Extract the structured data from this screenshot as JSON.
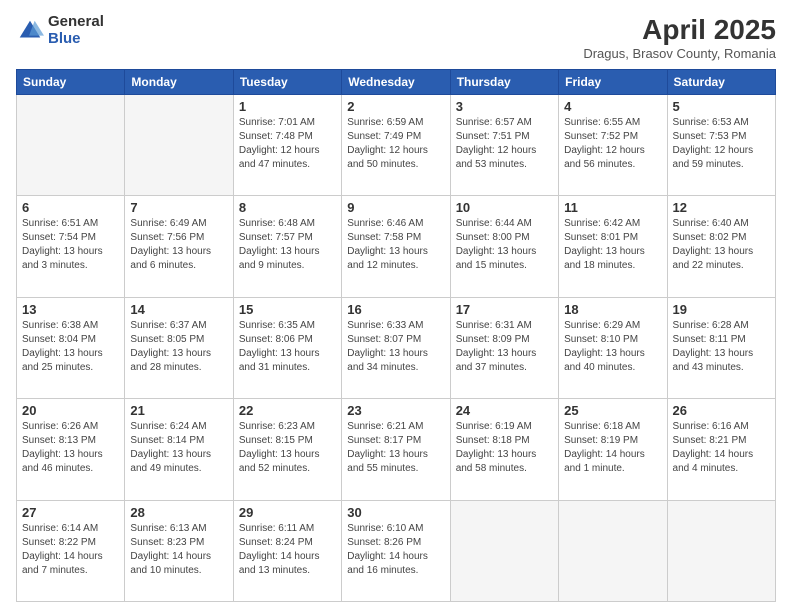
{
  "logo": {
    "general": "General",
    "blue": "Blue"
  },
  "title": "April 2025",
  "subtitle": "Dragus, Brasov County, Romania",
  "weekdays": [
    "Sunday",
    "Monday",
    "Tuesday",
    "Wednesday",
    "Thursday",
    "Friday",
    "Saturday"
  ],
  "weeks": [
    [
      {
        "day": "",
        "info": ""
      },
      {
        "day": "",
        "info": ""
      },
      {
        "day": "1",
        "info": "Sunrise: 7:01 AM\nSunset: 7:48 PM\nDaylight: 12 hours and 47 minutes."
      },
      {
        "day": "2",
        "info": "Sunrise: 6:59 AM\nSunset: 7:49 PM\nDaylight: 12 hours and 50 minutes."
      },
      {
        "day": "3",
        "info": "Sunrise: 6:57 AM\nSunset: 7:51 PM\nDaylight: 12 hours and 53 minutes."
      },
      {
        "day": "4",
        "info": "Sunrise: 6:55 AM\nSunset: 7:52 PM\nDaylight: 12 hours and 56 minutes."
      },
      {
        "day": "5",
        "info": "Sunrise: 6:53 AM\nSunset: 7:53 PM\nDaylight: 12 hours and 59 minutes."
      }
    ],
    [
      {
        "day": "6",
        "info": "Sunrise: 6:51 AM\nSunset: 7:54 PM\nDaylight: 13 hours and 3 minutes."
      },
      {
        "day": "7",
        "info": "Sunrise: 6:49 AM\nSunset: 7:56 PM\nDaylight: 13 hours and 6 minutes."
      },
      {
        "day": "8",
        "info": "Sunrise: 6:48 AM\nSunset: 7:57 PM\nDaylight: 13 hours and 9 minutes."
      },
      {
        "day": "9",
        "info": "Sunrise: 6:46 AM\nSunset: 7:58 PM\nDaylight: 13 hours and 12 minutes."
      },
      {
        "day": "10",
        "info": "Sunrise: 6:44 AM\nSunset: 8:00 PM\nDaylight: 13 hours and 15 minutes."
      },
      {
        "day": "11",
        "info": "Sunrise: 6:42 AM\nSunset: 8:01 PM\nDaylight: 13 hours and 18 minutes."
      },
      {
        "day": "12",
        "info": "Sunrise: 6:40 AM\nSunset: 8:02 PM\nDaylight: 13 hours and 22 minutes."
      }
    ],
    [
      {
        "day": "13",
        "info": "Sunrise: 6:38 AM\nSunset: 8:04 PM\nDaylight: 13 hours and 25 minutes."
      },
      {
        "day": "14",
        "info": "Sunrise: 6:37 AM\nSunset: 8:05 PM\nDaylight: 13 hours and 28 minutes."
      },
      {
        "day": "15",
        "info": "Sunrise: 6:35 AM\nSunset: 8:06 PM\nDaylight: 13 hours and 31 minutes."
      },
      {
        "day": "16",
        "info": "Sunrise: 6:33 AM\nSunset: 8:07 PM\nDaylight: 13 hours and 34 minutes."
      },
      {
        "day": "17",
        "info": "Sunrise: 6:31 AM\nSunset: 8:09 PM\nDaylight: 13 hours and 37 minutes."
      },
      {
        "day": "18",
        "info": "Sunrise: 6:29 AM\nSunset: 8:10 PM\nDaylight: 13 hours and 40 minutes."
      },
      {
        "day": "19",
        "info": "Sunrise: 6:28 AM\nSunset: 8:11 PM\nDaylight: 13 hours and 43 minutes."
      }
    ],
    [
      {
        "day": "20",
        "info": "Sunrise: 6:26 AM\nSunset: 8:13 PM\nDaylight: 13 hours and 46 minutes."
      },
      {
        "day": "21",
        "info": "Sunrise: 6:24 AM\nSunset: 8:14 PM\nDaylight: 13 hours and 49 minutes."
      },
      {
        "day": "22",
        "info": "Sunrise: 6:23 AM\nSunset: 8:15 PM\nDaylight: 13 hours and 52 minutes."
      },
      {
        "day": "23",
        "info": "Sunrise: 6:21 AM\nSunset: 8:17 PM\nDaylight: 13 hours and 55 minutes."
      },
      {
        "day": "24",
        "info": "Sunrise: 6:19 AM\nSunset: 8:18 PM\nDaylight: 13 hours and 58 minutes."
      },
      {
        "day": "25",
        "info": "Sunrise: 6:18 AM\nSunset: 8:19 PM\nDaylight: 14 hours and 1 minute."
      },
      {
        "day": "26",
        "info": "Sunrise: 6:16 AM\nSunset: 8:21 PM\nDaylight: 14 hours and 4 minutes."
      }
    ],
    [
      {
        "day": "27",
        "info": "Sunrise: 6:14 AM\nSunset: 8:22 PM\nDaylight: 14 hours and 7 minutes."
      },
      {
        "day": "28",
        "info": "Sunrise: 6:13 AM\nSunset: 8:23 PM\nDaylight: 14 hours and 10 minutes."
      },
      {
        "day": "29",
        "info": "Sunrise: 6:11 AM\nSunset: 8:24 PM\nDaylight: 14 hours and 13 minutes."
      },
      {
        "day": "30",
        "info": "Sunrise: 6:10 AM\nSunset: 8:26 PM\nDaylight: 14 hours and 16 minutes."
      },
      {
        "day": "",
        "info": ""
      },
      {
        "day": "",
        "info": ""
      },
      {
        "day": "",
        "info": ""
      }
    ]
  ]
}
